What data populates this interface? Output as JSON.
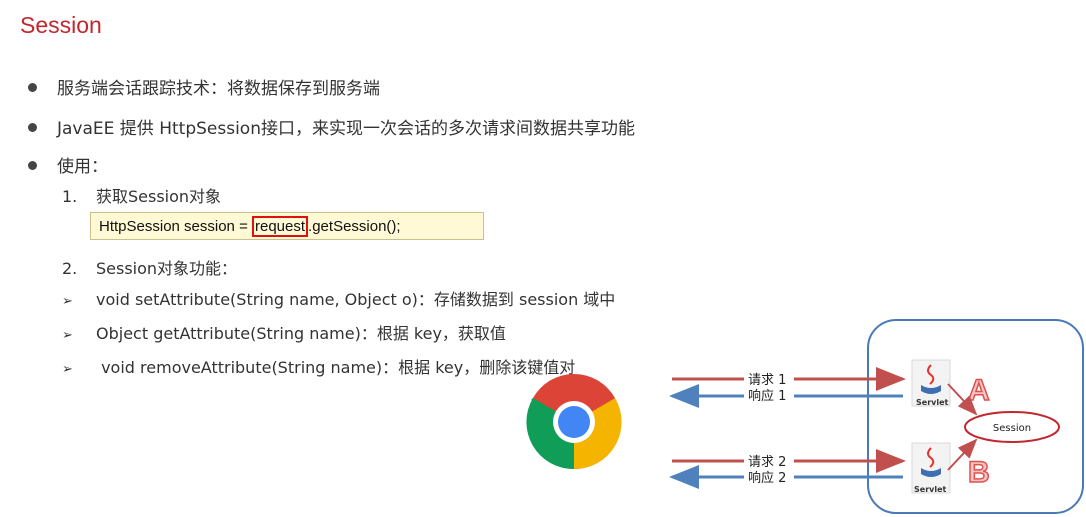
{
  "title": "Session",
  "bullets": [
    "服务端会话跟踪技术：将数据保存到服务端",
    "JavaEE 提供 HttpSession接口，来实现一次会话的多次请求间数据共享功能",
    "使用："
  ],
  "steps": [
    {
      "num": "1.",
      "text": "获取Session对象"
    },
    {
      "num": "2.",
      "text": "Session对象功能："
    }
  ],
  "code": {
    "before": "HttpSession session = ",
    "highlight": "request",
    "after": ".getSession();"
  },
  "methods": [
    {
      "mark": "➢",
      "text": "void setAttribute(String name, Object o)：存储数据到 session 域中"
    },
    {
      "mark": "➢",
      "text": "Object getAttribute(String name)：根据 key，获取值"
    },
    {
      "mark": "➢",
      "text": " void removeAttribute(String name)：根据 key，删除该键值对"
    }
  ],
  "diagram": {
    "req1": "请求 1",
    "resp1": "响应 1",
    "req2": "请求 2",
    "resp2": "响应 2",
    "servlet_a": "Servlet",
    "servlet_b": "Servlet",
    "letter_a": "A",
    "letter_b": "B",
    "session": "Session",
    "colors": {
      "request": "#c0504d",
      "response": "#4f81bd",
      "server_border": "#4a78b8",
      "session": "#c0282d"
    }
  }
}
